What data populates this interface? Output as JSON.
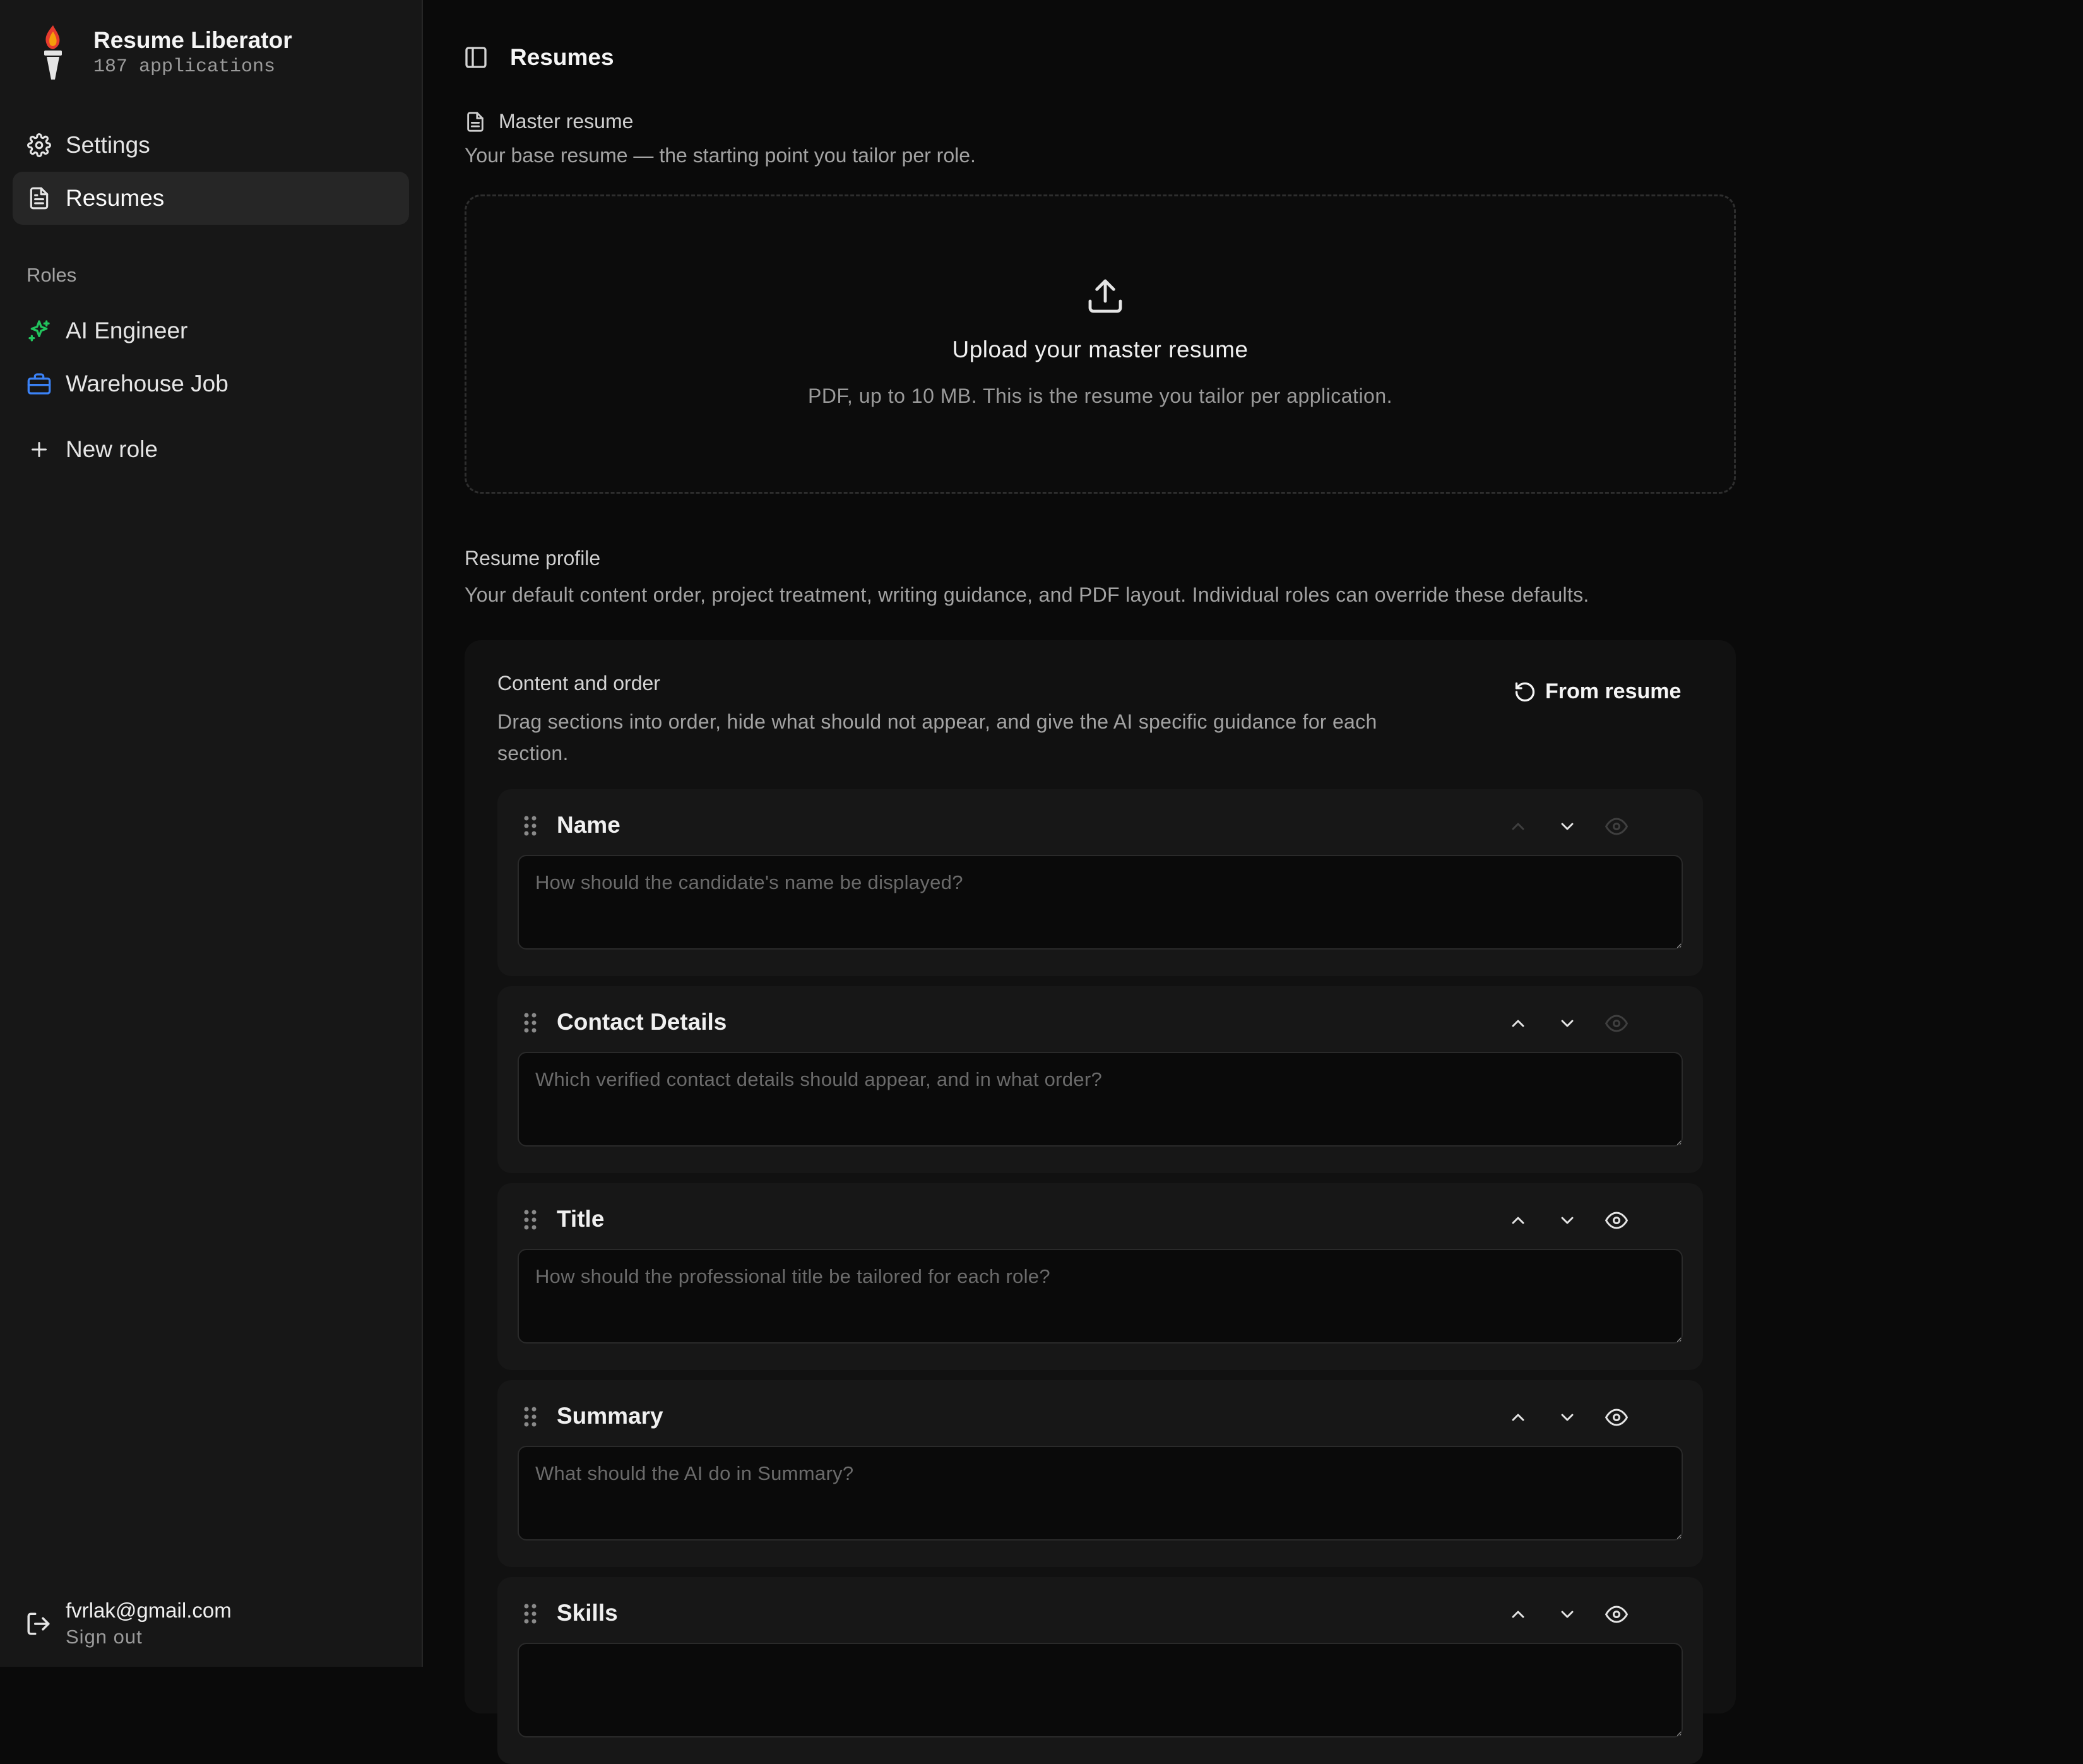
{
  "app": {
    "name": "Resume Liberator",
    "subtitle": "187 applications"
  },
  "sidebar": {
    "nav": [
      {
        "label": "Settings",
        "icon": "gear-icon"
      },
      {
        "label": "Resumes",
        "icon": "document-icon",
        "active": true
      }
    ],
    "roles_label": "Roles",
    "roles": [
      {
        "label": "AI Engineer",
        "icon": "sparkles-icon",
        "color": "#22c55e"
      },
      {
        "label": "Warehouse Job",
        "icon": "briefcase-icon",
        "color": "#3b82f6"
      }
    ],
    "new_role_label": "New role",
    "user": {
      "email": "fvrlak@gmail.com",
      "sign_out": "Sign out"
    }
  },
  "header": {
    "title": "Resumes"
  },
  "master_resume": {
    "label": "Master resume",
    "description": "Your base resume — the starting point you tailor per role.",
    "upload_title": "Upload your master resume",
    "upload_description": "PDF, up to 10 MB. This is the resume you tailor per application."
  },
  "resume_profile": {
    "label": "Resume profile",
    "description": "Your default content order, project treatment, writing guidance, and PDF layout. Individual roles can override these defaults."
  },
  "content_order": {
    "title": "Content and order",
    "description": "Drag sections into order, hide what should not appear, and give the AI specific guidance for each section.",
    "from_resume_label": "From resume",
    "sections": [
      {
        "title": "Name",
        "placeholder": "How should the candidate's name be displayed?",
        "value": ""
      },
      {
        "title": "Contact Details",
        "placeholder": "Which verified contact details should appear, and in what order?",
        "value": ""
      },
      {
        "title": "Title",
        "placeholder": "How should the professional title be tailored for each role?",
        "value": ""
      },
      {
        "title": "Summary",
        "placeholder": "What should the AI do in Summary?",
        "value": ""
      },
      {
        "title": "Skills",
        "placeholder": "",
        "value": ""
      }
    ]
  },
  "colors": {
    "background": "#0a0a0a",
    "sidebar": "#171717",
    "accent_green": "#22c55e",
    "accent_blue": "#3b82f6"
  }
}
